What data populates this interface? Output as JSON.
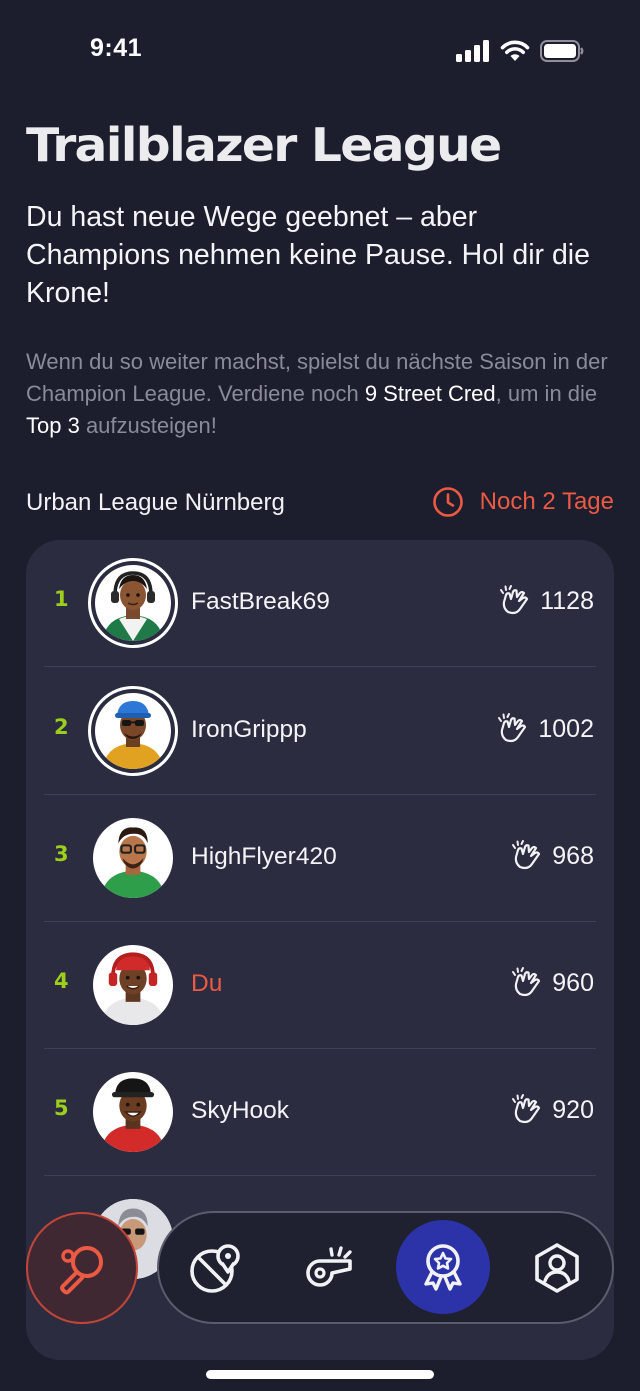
{
  "status_bar": {
    "time": "9:41"
  },
  "header": {
    "title": "Trailblazer League",
    "subtitle": "Du hast neue Wege geebnet – aber Champions nehmen keine Pause. Hol dir die Krone!",
    "info_prefix": "Wenn du so weiter machst, spielst du nächste Saison in der Champion League. Verdiene noch ",
    "info_cred": "9 Street Cred",
    "info_middle": ", um in die ",
    "info_top": "Top 3",
    "info_suffix": " aufzusteigen!"
  },
  "league": {
    "name": "Urban League Nürnberg",
    "countdown": "Noch 2 Tage",
    "accent_color": "#ec5a44",
    "rank_color": "#9ccf1c"
  },
  "leaderboard": [
    {
      "rank": "1",
      "name": "FastBreak69",
      "score": "1128",
      "ringed": true
    },
    {
      "rank": "2",
      "name": "IronGrippp",
      "score": "1002",
      "ringed": true
    },
    {
      "rank": "3",
      "name": "HighFlyer420",
      "score": "968",
      "ringed": false
    },
    {
      "rank": "4",
      "name": "Du",
      "score": "960",
      "ringed": false,
      "is_me": true
    },
    {
      "rank": "5",
      "name": "SkyHook",
      "score": "920",
      "ringed": false
    }
  ],
  "nav": {
    "items": [
      "ping-pong-icon",
      "map-ball-icon",
      "whistle-icon",
      "award-icon",
      "profile-icon"
    ],
    "active": "award-icon"
  }
}
